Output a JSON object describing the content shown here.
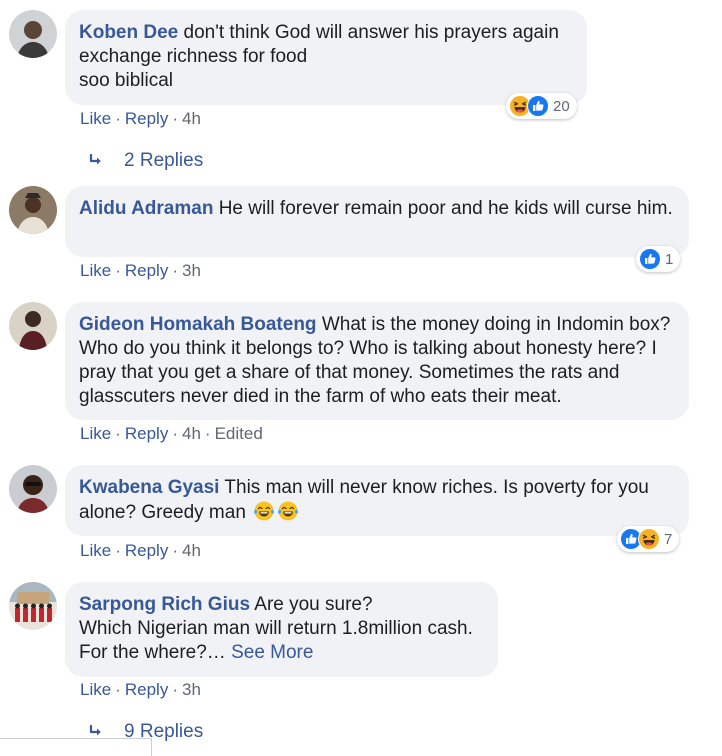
{
  "colors": {
    "link": "#385898",
    "bubble": "#f0f2f5",
    "meta": "#606770",
    "like_blue": "#1877f2",
    "haha_yellow": "#f7b125"
  },
  "comments": [
    {
      "author": "Koben Dee",
      "text": "don't think God will answer his prayers again exchange richness for food\nsoo biblical",
      "actions": {
        "like": "Like",
        "reply": "Reply",
        "time": "4h"
      },
      "reactions": {
        "icons": [
          "haha-icon",
          "like-icon"
        ],
        "count": "20"
      },
      "replies_label": "2 Replies"
    },
    {
      "author": "Alidu Adraman",
      "text": "He will forever remain poor and he kids will curse him.",
      "actions": {
        "like": "Like",
        "reply": "Reply",
        "time": "3h"
      },
      "reactions": {
        "icons": [
          "like-icon"
        ],
        "count": "1"
      }
    },
    {
      "author": "Gideon Homakah Boateng",
      "text": "What is the money doing in Indomin box? Who do you think it belongs to? Who is talking about honesty here? I pray that you get a share of that money. Sometimes the rats and glasscuters never died in the farm of who eats their meat.",
      "actions": {
        "like": "Like",
        "reply": "Reply",
        "time": "4h",
        "edited": "Edited"
      }
    },
    {
      "author": "Kwabena Gyasi",
      "text": "This man will never know riches. Is poverty for you alone? Greedy man",
      "inline_emoji": [
        "tears-of-joy-icon",
        "tears-of-joy-icon"
      ],
      "actions": {
        "like": "Like",
        "reply": "Reply",
        "time": "4h"
      },
      "reactions": {
        "icons": [
          "like-icon",
          "haha-icon"
        ],
        "count": "7"
      }
    },
    {
      "author": "Sarpong Rich Gius",
      "text": "Are you sure?\nWhich Nigerian man will return 1.8million cash.\nFor the where?…",
      "see_more": "See More",
      "actions": {
        "like": "Like",
        "reply": "Reply",
        "time": "3h"
      },
      "replies_label": "9 Replies"
    }
  ]
}
